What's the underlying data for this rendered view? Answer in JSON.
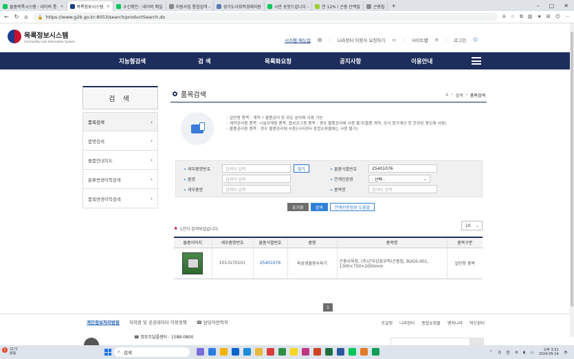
{
  "browser": {
    "tabs": [
      {
        "label": "물품목록시스템 : 네이버 통",
        "color": "#03c75a",
        "active": false
      },
      {
        "label": "목록정보시스템",
        "color": "#1b3c8a",
        "active": true
      },
      {
        "label": "수신확인 : 네이버 메일",
        "color": "#03c75a",
        "active": false
      },
      {
        "label": "지원사업 통합검색 -",
        "color": "#888888",
        "active": false
      },
      {
        "label": "경기도사회적경제지원",
        "color": "#5b7bb0",
        "active": false
      },
      {
        "label": "시만 숏붓드립니다 -",
        "color": "#03c75a",
        "active": false
      },
      {
        "label": "연 12%ㅣ곤충 단백질",
        "color": "#9acd32",
        "active": false
      },
      {
        "label": "곤충칩",
        "color": "#888888",
        "active": false
      }
    ],
    "url": "https://www.g2b.go.kr:8053/search/productSearch.do"
  },
  "header": {
    "logo_title": "목록정보시스템",
    "logo_subtitle": "Commodity Lists Information System",
    "util_links": [
      "시스템 매뉴얼",
      "나라장터 이용자 요청하기",
      "사이트맵",
      "로그인"
    ]
  },
  "gnb": [
    "지능형검색",
    "검 색",
    "목록화요청",
    "공지사항",
    "이용안내"
  ],
  "lnb": {
    "title": "검 색",
    "items": [
      "품목검색",
      "품명검색",
      "물품안내지도",
      "분류변경이력검색",
      "품목변경이력검색"
    ]
  },
  "main": {
    "title": "품목검색",
    "breadcrumb": [
      "검색",
      "품목검색"
    ],
    "guide": [
      "- 일반용 품목 : 계약 • 물품관리 등 모든 분야에 사용 가능",
      "- 계약관리용 품목: 시설자재용 품목, 협상공고용 품목 : 경우 물품관리에 사용 불가(물품 계약, 공사 원가계산 등 한정된 용도에 사용)",
      "- 물품관리용 품목 : 경우 물품관리에 사용(나라장터 종합쇼핑몰에는 사용 불가)"
    ],
    "search": {
      "detail_label": "세부품명번호",
      "detail_placeholder": "검색어 입력",
      "find_button": "찾기",
      "product_id_label": "물품식별번호",
      "product_id_value": "25401076",
      "name_label": "품명",
      "name_placeholder": "검색어 입력",
      "link_label": "연계인증명",
      "link_value": ": 선택 :",
      "detail_name_label": "세부품명",
      "detail_name_placeholder": "검색어 입력",
      "item_name_label": "품목명",
      "item_name_placeholder": "검색어 입력"
    },
    "actions": {
      "reset": "초기화",
      "search": "검색",
      "help": "연계인증정보 도움말"
    },
    "result_text": "1건이 검색되었습니다.",
    "page_size": "10",
    "table": {
      "headers": [
        "물품이미지",
        "세부품명번호",
        "물품식별번호",
        "품명",
        "품목명",
        "품목구분"
      ],
      "rows": [
        {
          "detail_no": "1013170101",
          "product_id": "25401076",
          "name": "육성생물용사육기",
          "item": "곤충사육장, (주)곤자강표부착)곤충칩, BUGS-001, 1300×750×2000mm",
          "category": "일반용 품목"
        }
      ]
    },
    "pagination": [
      "1"
    ]
  },
  "footer": {
    "links": [
      "개인정보처리방침",
      "저작권 및 공공데이터 이용정책",
      "☎ 담당자연락처"
    ],
    "right_links": [
      "조달청",
      "나라장터",
      "종합쇼핑몰",
      "벤처나라",
      "혁신장터"
    ],
    "contact": "☎ 정부조달콜센터 : 1588-0800"
  },
  "taskbar": {
    "weather_temp": "21°C",
    "weather_desc": "맑음",
    "search_placeholder": "검색",
    "badge": "1",
    "ime": "가",
    "ime2": "한",
    "time": "오후 3:51",
    "date": "2024-05-14"
  }
}
